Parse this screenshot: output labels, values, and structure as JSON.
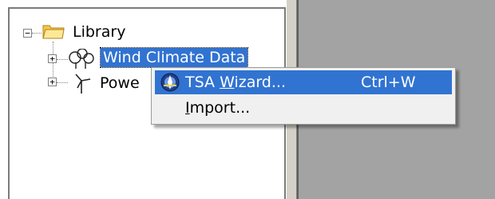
{
  "tree": {
    "root": {
      "label": "Library",
      "expander": "−",
      "icon": "folder-icon"
    },
    "children": [
      {
        "label": "Wind Climate Data",
        "expander": "+",
        "icon": "tree-icon",
        "selected": true
      },
      {
        "label": "Powe",
        "expander": "+",
        "icon": "wind-turbine-icon",
        "selected": false
      }
    ]
  },
  "context_menu": {
    "items": [
      {
        "label_before": "TSA ",
        "label_mnemonic": "W",
        "label_after": "izard...",
        "shortcut": "Ctrl+W",
        "icon": "tsa-wizard-icon",
        "active": true
      },
      {
        "label_before": "",
        "label_mnemonic": "I",
        "label_after": "mport...",
        "shortcut": "",
        "icon": "",
        "active": false
      }
    ]
  },
  "colors": {
    "selection": "#3173d1",
    "folder": "#f6c647",
    "pane_gray": "#a3a3a3"
  }
}
